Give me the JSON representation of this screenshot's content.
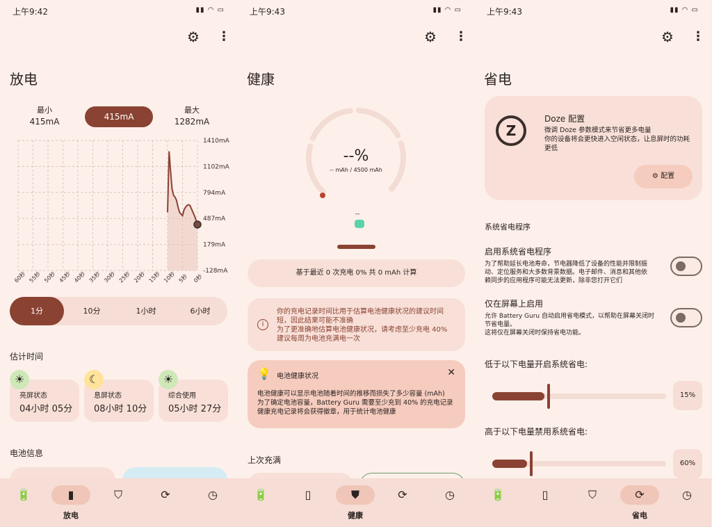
{
  "status": {
    "p1_time": "上午9:42",
    "p2_time": "上午9:43",
    "p3_time": "上午9:43",
    "right": "▮▮ ◠ ▭"
  },
  "discharge": {
    "title": "放电",
    "min_label": "最小",
    "min_value": "415mA",
    "current": "415mA",
    "max_label": "最大",
    "max_value": "1282mA",
    "ranges": [
      "1分",
      "10分",
      "1小时",
      "6小时"
    ],
    "estimate_title": "估计时间",
    "estimates": [
      {
        "label": "亮屏状态",
        "value": "04小时 05分"
      },
      {
        "label": "息屏状态",
        "value": "08小时 10分"
      },
      {
        "label": "综合使用",
        "value": "05小时 27分"
      }
    ],
    "battery_info": "电池信息"
  },
  "chart_data": {
    "type": "line",
    "title": "",
    "xlabel": "",
    "ylabel": "",
    "x_ticks": [
      "60秒",
      "55秒",
      "50秒",
      "45秒",
      "40秒",
      "35秒",
      "30秒",
      "25秒",
      "20秒",
      "15秒",
      "10秒",
      "5秒",
      "0秒"
    ],
    "y_ticks": [
      "1410mA",
      "1102mA",
      "794mA",
      "487mA",
      "179mA",
      "-128mA"
    ],
    "ylim": [
      -128,
      1410
    ],
    "series": [
      {
        "x": [
          -10,
          -9.5,
          -9,
          -8.5,
          -8,
          -7.5,
          -7,
          -6.5,
          -6,
          -5.5,
          -5,
          -4.5,
          -4,
          -3.5,
          -3,
          -2.5,
          -2,
          -1.5,
          -1,
          -0.5,
          0
        ],
        "values": [
          560,
          1282,
          1050,
          840,
          760,
          740,
          700,
          620,
          560,
          540,
          520,
          590,
          620,
          640,
          650,
          640,
          600,
          560,
          520,
          470,
          415
        ]
      }
    ]
  },
  "health": {
    "title": "健康",
    "percent": "--%",
    "capacity": "-- mAh / 4500 mAh",
    "dash": "--",
    "basis": "基于最近 0 次充电 0% 共 0 mAh 计算",
    "warning": "你的充电记录时间比用于估算电池健康状况的建议时间短，因此结果可能不准确\n为了更准确地估算电池健康状况，请考虑至少充电 40%\n建议每周为电池充满电一次",
    "status_title": "电池健康状况",
    "status_text": "电池健康可以显示电池随着时间的推移而损失了多少容量 (mAh)\n为了确定电池容量，Battery Guru 需要至少充到 40% 的充电记录\n健康充电记录将会获得徽章，用于统计电池健康",
    "last_full": "上次充满"
  },
  "saver": {
    "title": "省电",
    "doze_title": "Doze 配置",
    "doze_text": "微调 Doze 参数模式来节省更多电量\n你的设备将会更快进入空闲状态，让息屏时的功耗更低",
    "doze_button": "配置",
    "sys_section": "系统省电程序",
    "enable_title": "启用系统省电程序",
    "enable_text": "为了帮助延长电池寿命，节电器降低了设备的性能并限制振动、定位服务和大多数背景数据。电子邮件、消息和其他依赖同步的应用程序可能无法更新，除非您打开它们",
    "screen_title": "仅在屏幕上启用",
    "screen_text": "允许 Battery Guru 自动启用省电模式，以帮助在屏幕关闭时节省电量。\n这将仅在屏幕关闭时保持省电功能。",
    "below_title": "低于以下电量开启系统省电:",
    "below_pct": "15%",
    "below_value": 0.15,
    "above_title": "高于以下电量禁用系统省电:",
    "above_pct": "60%",
    "above_value": 0.06
  },
  "nav": {
    "discharge": "放电",
    "health": "健康",
    "saver": "省电"
  }
}
